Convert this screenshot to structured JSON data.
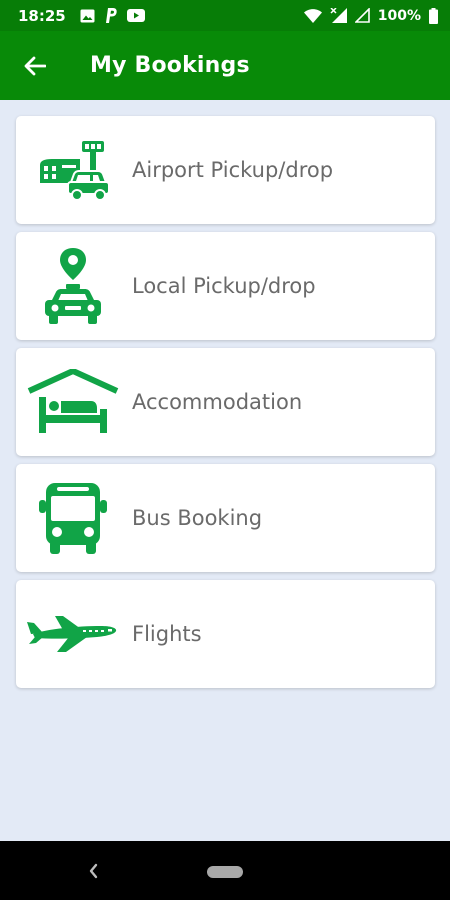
{
  "status_bar": {
    "time": "18:25",
    "left_icons": [
      "image-icon",
      "parking-icon",
      "youtube-icon"
    ],
    "right_icons": [
      "wifi-icon",
      "signal-icon",
      "signal-empty-icon",
      "battery-icon"
    ],
    "battery": "100%"
  },
  "app_bar": {
    "title": "My Bookings",
    "back_icon": "arrow-back-icon"
  },
  "bookings": [
    {
      "label": "Airport Pickup/drop",
      "icon": "airport-taxi-icon"
    },
    {
      "label": "Local Pickup/drop",
      "icon": "local-taxi-icon"
    },
    {
      "label": "Accommodation",
      "icon": "hotel-bed-icon"
    },
    {
      "label": "Bus Booking",
      "icon": "bus-icon"
    },
    {
      "label": "Flights",
      "icon": "airplane-icon"
    }
  ],
  "colors": {
    "primary": "#088a08",
    "status_bar": "#077d07",
    "icon_green": "#11a447",
    "background": "#e3eaf6",
    "label_text": "#6a6a6a"
  }
}
